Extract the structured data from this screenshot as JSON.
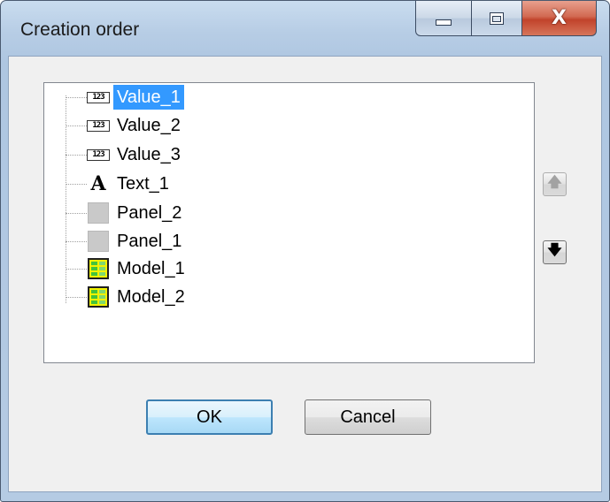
{
  "window": {
    "title": "Creation order",
    "minimize_glyph": "",
    "close_glyph": "X"
  },
  "tree": {
    "items": [
      {
        "label": "Value_1",
        "icon": "numeric-value-icon",
        "selected": true
      },
      {
        "label": "Value_2",
        "icon": "numeric-value-icon",
        "selected": false
      },
      {
        "label": "Value_3",
        "icon": "numeric-value-icon",
        "selected": false
      },
      {
        "label": "Text_1",
        "icon": "text-icon",
        "selected": false
      },
      {
        "label": "Panel_2",
        "icon": "panel-icon",
        "selected": false
      },
      {
        "label": "Panel_1",
        "icon": "panel-icon",
        "selected": false
      },
      {
        "label": "Model_1",
        "icon": "model-icon",
        "selected": false
      },
      {
        "label": "Model_2",
        "icon": "model-icon",
        "selected": false
      }
    ],
    "numeric_icon_text": "123",
    "text_icon_glyph": "A"
  },
  "side_buttons": {
    "up_glyph": "🡅",
    "down_glyph": "🡇",
    "up_enabled": false,
    "down_enabled": true
  },
  "buttons": {
    "ok_label": "OK",
    "cancel_label": "Cancel"
  },
  "colors": {
    "selection": "#3399ff",
    "close_button": "#c1432b",
    "frame": "#b7cde5"
  }
}
